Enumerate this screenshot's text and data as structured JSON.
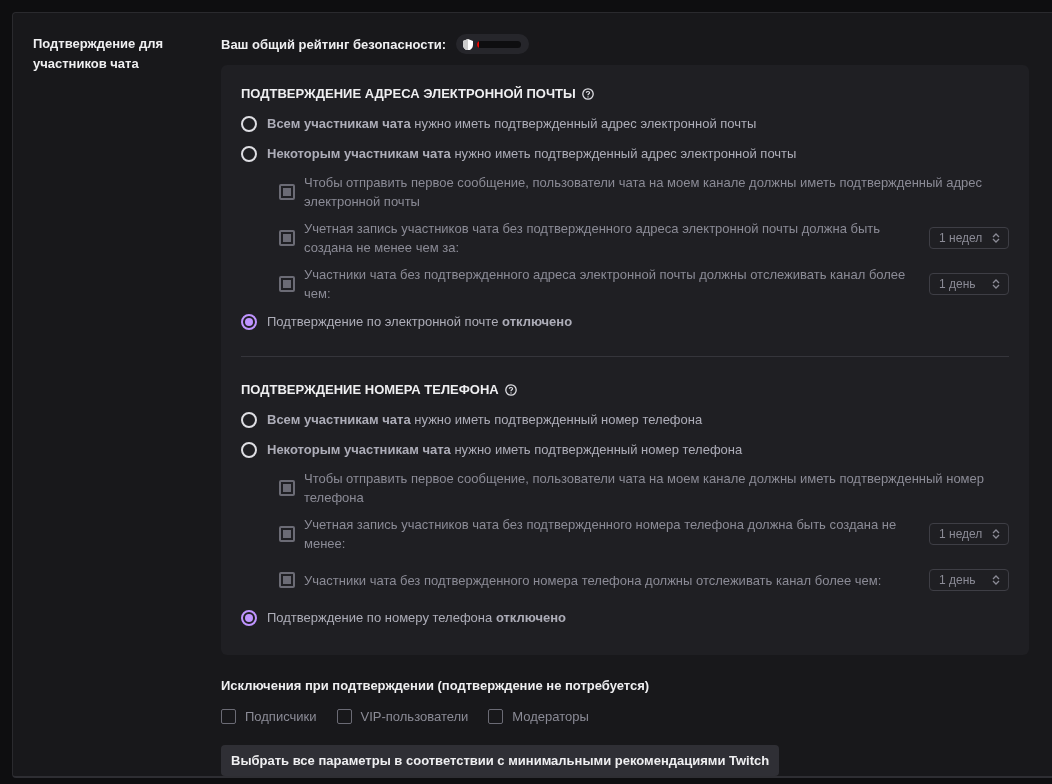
{
  "section_title": "Подтверждение для участников чата",
  "security_rating": {
    "label": "Ваш общий рейтинг безопасности:",
    "level": 0.05
  },
  "groups": [
    {
      "title": "ПОДТВЕРЖДЕНИЕ АДРЕСА ЭЛЕКТРОННОЙ ПОЧТЫ",
      "options": [
        {
          "kind": "radio",
          "text": "**Всем участникам чата** нужно иметь подтвержденный адрес электронной почты",
          "selected": false
        },
        {
          "kind": "radio",
          "text": "**Некоторым участникам чата** нужно иметь подтвержденный адрес электронной почты",
          "selected": false
        },
        {
          "kind": "check",
          "text": "Чтобы отправить первое сообщение, пользователи чата на моем канале должны иметь подтвержденный адрес электронной почты",
          "checked": true,
          "disabled": true
        },
        {
          "kind": "check",
          "text": "Учетная запись участников чата без подтвержденного адреса электронной почты должна быть создана не менее чем за:",
          "checked": true,
          "disabled": true,
          "select": "1 недел"
        },
        {
          "kind": "check",
          "text": "Участники чата без подтвержденного адреса электронной почты должны отслеживать канал более чем:",
          "checked": true,
          "disabled": true,
          "select": "1 день"
        },
        {
          "kind": "radio",
          "text": "Подтверждение по электронной почте **отключено**",
          "selected": true
        }
      ]
    },
    {
      "title": "ПОДТВЕРЖДЕНИЕ НОМЕРА ТЕЛЕФОНА",
      "options": [
        {
          "kind": "radio",
          "text": "**Всем участникам чата** нужно иметь подтвержденный номер телефона",
          "selected": false
        },
        {
          "kind": "radio",
          "text": "**Некоторым участникам чата** нужно иметь подтвержденный номер телефона",
          "selected": false
        },
        {
          "kind": "check",
          "text": "Чтобы отправить первое сообщение, пользователи чата на моем канале должны иметь подтвержденный номер телефона",
          "checked": true,
          "disabled": true
        },
        {
          "kind": "check",
          "text": "Учетная запись участников чата без подтвержденного номера телефона должна быть создана не менее:",
          "checked": true,
          "disabled": true,
          "select": "1 недел"
        },
        {
          "kind": "check",
          "text": "Участники чата без подтвержденного номера телефона должны отслеживать канал более чем:",
          "checked": true,
          "disabled": true,
          "select": "1 день"
        },
        {
          "kind": "radio",
          "text": "Подтверждение по номеру телефона **отключено**",
          "selected": true
        }
      ]
    }
  ],
  "exemptions": {
    "title": "Исключения при подтверждении (подтверждение не потребуется)",
    "items": [
      {
        "label": "Подписчики",
        "checked": false
      },
      {
        "label": "VIP-пользователи",
        "checked": false
      },
      {
        "label": "Модераторы",
        "checked": false
      }
    ]
  },
  "apply_button": "Выбрать все параметры в соответствии с минимальными рекомендациями Twitch"
}
